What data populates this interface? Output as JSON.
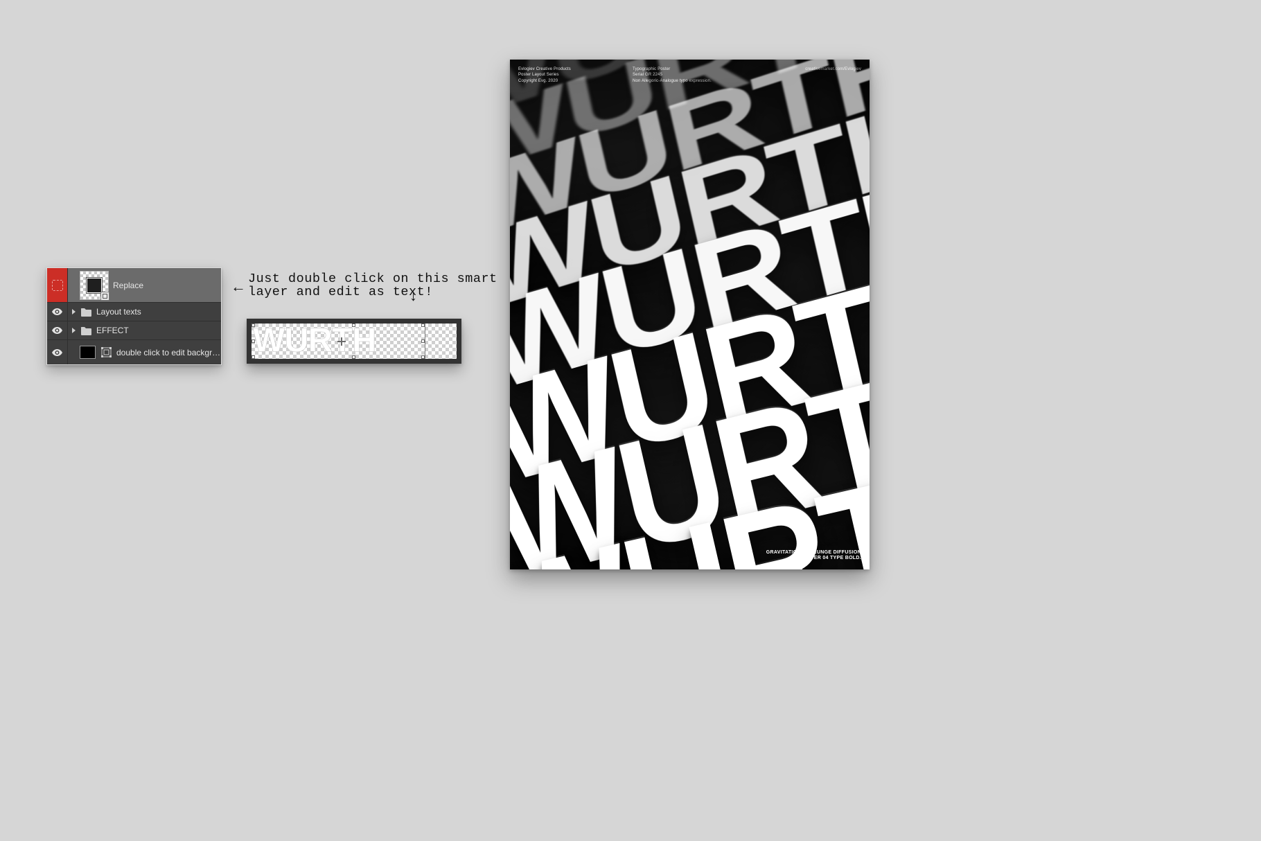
{
  "layers_panel": {
    "rows": [
      {
        "label": "Replace"
      },
      {
        "label": "Layout texts"
      },
      {
        "label": "EFFECT"
      },
      {
        "label": "double click to edit backgro..."
      }
    ]
  },
  "instruction": {
    "line1": "Just double click on this smart",
    "line2": "layer and edit as text!"
  },
  "arrows": {
    "left": "←",
    "down": "↓"
  },
  "smart_object": {
    "word": "WURTH"
  },
  "poster": {
    "big_word": "WURTH",
    "top_meta": {
      "col1_line1": "Evlogiev Creative Products",
      "col1_line2": "Poster Layout Series",
      "col1_line3": "Copyright Evg. 2020",
      "col2_line1": "Typographic Poster",
      "col2_line2": "Serial GR 2245",
      "col2_line3": "Non Allegoric-Analogue typo expression.",
      "col3_line1": "creativemarket.com/Evlogiev"
    },
    "bottom_meta": {
      "line1": "GRAVITATIONAL GRUNGE DIFFUSION",
      "line2": "BLASTER 04 TYPE BOLD."
    }
  }
}
